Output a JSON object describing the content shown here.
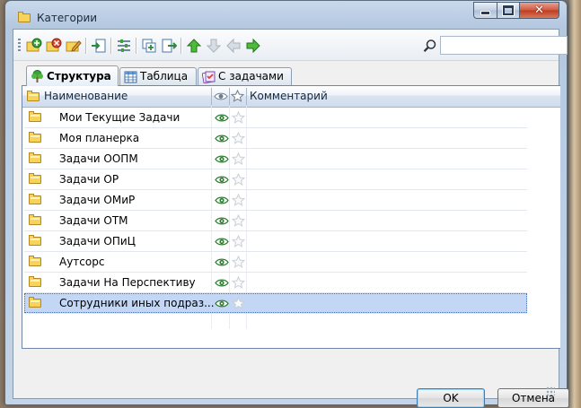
{
  "window": {
    "title": "Категории"
  },
  "toolbar": {
    "search_placeholder": "",
    "buttons": [
      "add-category-icon",
      "delete-category-icon",
      "edit-category-icon",
      "import-icon",
      "settings-icon",
      "expand-icon",
      "export-icon",
      "arrow-up-icon",
      "arrow-down-icon",
      "arrow-left-icon",
      "arrow-right-icon"
    ]
  },
  "tabs": [
    {
      "label": "Структура",
      "active": true,
      "icon": "tree-icon"
    },
    {
      "label": "Таблица",
      "active": false,
      "icon": "table-icon"
    },
    {
      "label": "С задачами",
      "active": false,
      "icon": "tasks-icon"
    }
  ],
  "grid": {
    "columns": {
      "name": "Наименование",
      "comment": "Комментарий"
    },
    "rows": [
      {
        "name": "Мои Текущие Задачи",
        "comment": "",
        "visible": true,
        "favorite": false
      },
      {
        "name": "Моя планерка",
        "comment": "",
        "visible": true,
        "favorite": false
      },
      {
        "name": "Задачи ООПМ",
        "comment": "",
        "visible": true,
        "favorite": false
      },
      {
        "name": "Задачи ОР",
        "comment": "",
        "visible": true,
        "favorite": false
      },
      {
        "name": "Задачи ОМиР",
        "comment": "",
        "visible": true,
        "favorite": false
      },
      {
        "name": "Задачи ОТМ",
        "comment": "",
        "visible": true,
        "favorite": false
      },
      {
        "name": "Задачи ОПиЦ",
        "comment": "",
        "visible": true,
        "favorite": false
      },
      {
        "name": "Аутсорс",
        "comment": "",
        "visible": true,
        "favorite": false
      },
      {
        "name": "Задачи На Перспективу",
        "comment": "",
        "visible": true,
        "favorite": false
      },
      {
        "name": "Сотрудники иных подраз...",
        "comment": "",
        "visible": true,
        "favorite": false,
        "selected": true
      }
    ]
  },
  "footer": {
    "ok_label": "OK",
    "cancel_label": "Отмена"
  },
  "colors": {
    "selection": "#c3d6f4",
    "folder": "#f7d35a",
    "eye": "#2e7d32"
  }
}
